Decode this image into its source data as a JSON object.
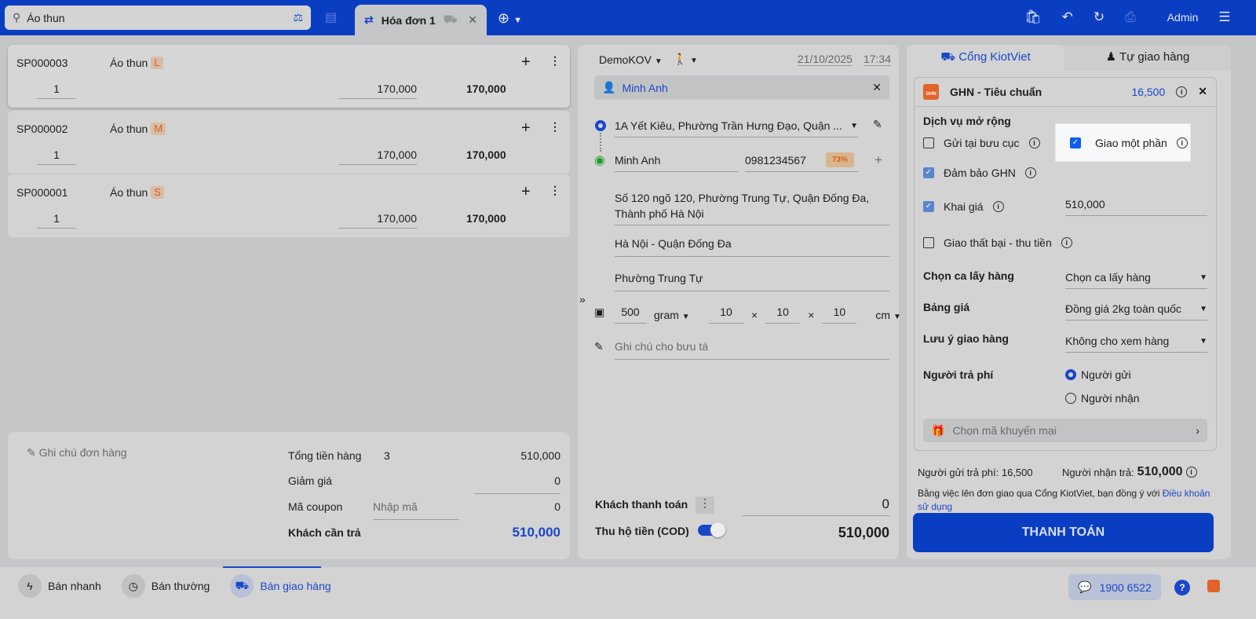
{
  "header": {
    "search_value": "Áo thun",
    "tab_label": "Hóa đơn 1",
    "user": "Admin"
  },
  "items": [
    {
      "code": "SP000003",
      "name": "Áo thun",
      "variant": "L",
      "qty": "1",
      "price": "170,000",
      "total": "170,000"
    },
    {
      "code": "SP000002",
      "name": "Áo thun",
      "variant": "M",
      "qty": "1",
      "price": "170,000",
      "total": "170,000"
    },
    {
      "code": "SP000001",
      "name": "Áo thun",
      "variant": "S",
      "qty": "1",
      "price": "170,000",
      "total": "170,000"
    }
  ],
  "summary": {
    "note": "Ghi chú đơn hàng",
    "total_label": "Tổng tiền hàng",
    "total_qty": "3",
    "total": "510,000",
    "discount_label": "Giảm giá",
    "discount": "0",
    "coupon_label": "Mã coupon",
    "coupon_placeholder": "Nhập mã",
    "coupon": "0",
    "due_label": "Khách cần trả",
    "due": "510,000"
  },
  "order": {
    "branch": "DemoKOV",
    "date": "21/10/2025",
    "time": "17:34",
    "customer": "Minh Anh",
    "from_address": "1A Yết Kiêu, Phường Trần Hưng Đạo, Quận ...",
    "recv_name": "Minh Anh",
    "recv_phone": "0981234567",
    "success_rate": "73%",
    "address": "Số 120 ngõ 120, Phường Trung Tự, Quận Đống Đa, Thành phố Hà Nội",
    "district": "Hà Nội - Quận Đống Đa",
    "ward": "Phường Trung Tự",
    "weight": "500",
    "weight_unit": "gram",
    "len": "10",
    "wid": "10",
    "hei": "10",
    "dim_unit": "cm",
    "note_placeholder": "Ghi chú cho bưu tá",
    "pay_label": "Khách thanh toán",
    "pay_value": "0",
    "cod_label": "Thu hộ tiền (COD)",
    "cod_value": "510,000"
  },
  "shipping": {
    "tab1": "Cổng KiotViet",
    "tab2": "Tự giao hàng",
    "carrier": "GHN - Tiêu chuẩn",
    "fee": "16,500",
    "ext_title": "Dịch vụ mở rộng",
    "opt_post": "Gửi tại bưu cục",
    "opt_partial": "Giao một phần",
    "opt_insure": "Đảm bảo GHN",
    "opt_declare": "Khai giá",
    "declare_value": "510,000",
    "opt_fail": "Giao thất bại - thu tiền",
    "shift_label": "Chọn ca lấy hàng",
    "shift_value": "Chọn ca lấy hàng",
    "price_label": "Bảng giá",
    "price_value": "Đồng giá 2kg toàn quốc",
    "note_label": "Lưu ý giao hàng",
    "note_value": "Không cho xem hàng",
    "payer_label": "Người trả phí",
    "payer_sender": "Người gửi",
    "payer_receiver": "Người nhận",
    "promo": "Chọn mã khuyến mại",
    "sender_pays": "Người gửi trả phí: 16,500",
    "receiver_pays_label": "Người nhận trả:",
    "receiver_pays": "510,000",
    "terms": "Bằng việc lên đơn giao qua Cổng KiotViet, bạn đồng ý với",
    "terms_link": "Điều khoản sử dụng",
    "checkout": "THANH TOÁN"
  },
  "bottom": {
    "quick": "Bán nhanh",
    "normal": "Bán thường",
    "delivery": "Bán giao hàng",
    "hotline": "1900 6522"
  }
}
